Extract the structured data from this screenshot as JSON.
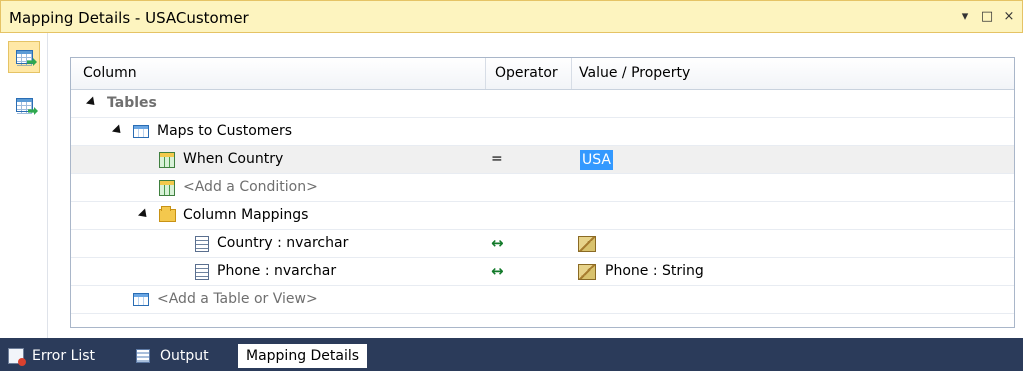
{
  "window": {
    "title": "Mapping Details - USACustomer",
    "controls": [
      "▾",
      "□",
      "×"
    ]
  },
  "grid": {
    "headers": {
      "column": "Column",
      "operator": "Operator",
      "value": "Value / Property"
    },
    "rows": [
      {
        "label": "Tables",
        "operator": "",
        "value": ""
      },
      {
        "label": "Maps to Customers",
        "operator": "",
        "value": ""
      },
      {
        "label": "When Country",
        "operator": "=",
        "value": "USA"
      },
      {
        "label": "<Add a Condition>",
        "operator": "",
        "value": ""
      },
      {
        "label": "Column Mappings",
        "operator": "",
        "value": ""
      },
      {
        "label": "Country : nvarchar",
        "operator": "↔",
        "value": ""
      },
      {
        "label": "Phone : nvarchar",
        "operator": "↔",
        "value": "Phone : String"
      },
      {
        "label": "<Add a Table or View>",
        "operator": "",
        "value": ""
      }
    ]
  },
  "tabs": [
    {
      "label": "Error List"
    },
    {
      "label": "Output"
    },
    {
      "label": "Mapping Details"
    }
  ]
}
